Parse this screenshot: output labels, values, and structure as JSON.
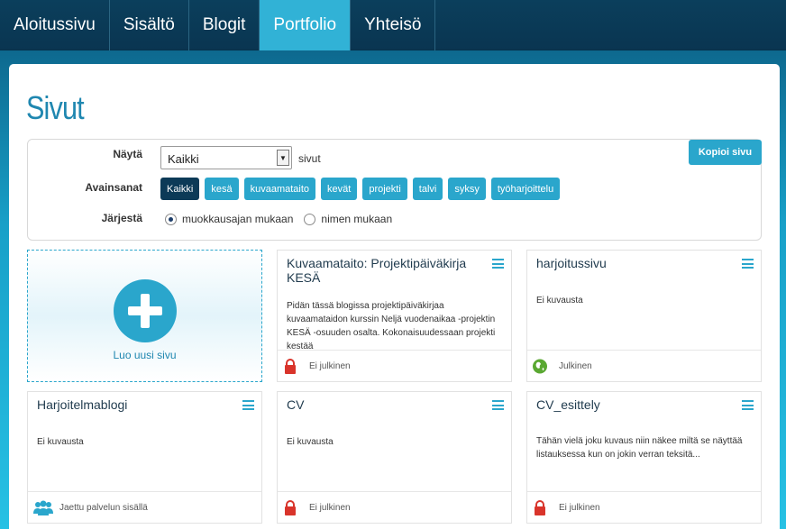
{
  "nav": {
    "items": [
      {
        "label": "Aloitussivu"
      },
      {
        "label": "Sisältö"
      },
      {
        "label": "Blogit"
      },
      {
        "label": "Portfolio"
      },
      {
        "label": "Yhteisö"
      }
    ],
    "active_index": 3
  },
  "page_title": "Sivut",
  "filters": {
    "show_label": "Näytä",
    "show_select_value": "Kaikki",
    "show_suffix": "sivut",
    "tags_label": "Avainsanat",
    "tags": [
      "Kaikki",
      "kesä",
      "kuvaamataito",
      "kevät",
      "projekti",
      "talvi",
      "syksy",
      "työharjoittelu"
    ],
    "active_tag": "Kaikki",
    "sort_label": "Järjestä",
    "sort_options": [
      "muokkausajan mukaan",
      "nimen mukaan"
    ],
    "sort_selected": "muokkausajan mukaan",
    "copy_button": "Kopioi sivu"
  },
  "new_page": {
    "label": "Luo uusi sivu"
  },
  "cards": [
    {
      "title": "Kuvaamataito: Projektipäiväkirja KESÄ",
      "description": "Pidän tässä blogissa projektipäiväkirjaa kuvaamataidon kurssin Neljä vuodenaikaa -projektin  KESÄ -osuuden osalta. Kokonaisuudessaan projekti kestää",
      "status": "Ei julkinen",
      "status_icon": "lock-icon"
    },
    {
      "title": "harjoitussivu",
      "description": "Ei kuvausta",
      "status": "Julkinen",
      "status_icon": "globe-icon"
    },
    {
      "title": "Harjoitelmablogi",
      "description": "Ei kuvausta",
      "status": "Jaettu palvelun sisällä",
      "status_icon": "users-icon"
    },
    {
      "title": "CV",
      "description": "Ei kuvausta",
      "status": "Ei julkinen",
      "status_icon": "lock-icon"
    },
    {
      "title": "CV_esittely",
      "description": "Tähän vielä joku kuvaus niin näkee miltä se näyttää listauksessa kun on jokin verran teksitä...",
      "status": "Ei julkinen",
      "status_icon": "lock-icon"
    }
  ],
  "colors": {
    "accent": "#2aa6cc",
    "nav_bg": "#0b3f5c",
    "active_tag": "#0c3a57",
    "lock": "#d9342b",
    "globe": "#5aa832",
    "users": "#2aa6cc"
  }
}
